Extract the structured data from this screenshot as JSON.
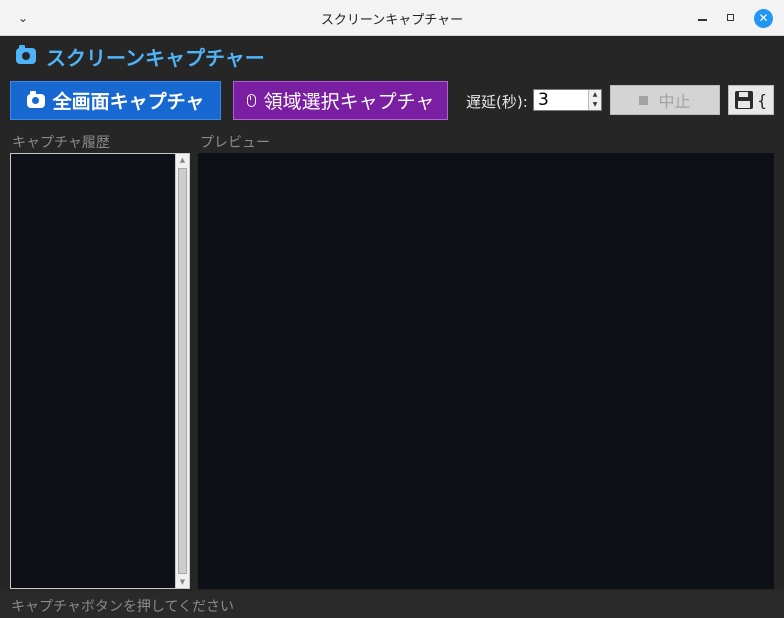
{
  "window": {
    "title": "スクリーンキャプチャー",
    "menu_glyph": "⌄",
    "close_glyph": "✕"
  },
  "app": {
    "heading": "スクリーンキャプチャー"
  },
  "toolbar": {
    "fullscreen_label": "全画面キャプチャ",
    "region_label": "領域選択キャプチャ",
    "delay_label": "遅延(秒):",
    "delay_value": "3",
    "stop_label": "中止",
    "save_partial": "{"
  },
  "history": {
    "label": "キャプチャ履歴",
    "items": []
  },
  "preview": {
    "label": "プレビュー"
  },
  "status": {
    "text": "キャプチャボタンを押してください"
  },
  "colors": {
    "accent": "#4fb3f7",
    "fullscreen_button": "#1769d1",
    "region_button": "#7b1fa2",
    "close_button": "#2196f3",
    "panel_background": "#0d1016"
  },
  "icons": {
    "app": "camera-icon",
    "fullscreen": "camera-icon",
    "region": "mouse-icon",
    "stop": "stop-square-icon",
    "save": "floppy-disk-icon"
  }
}
